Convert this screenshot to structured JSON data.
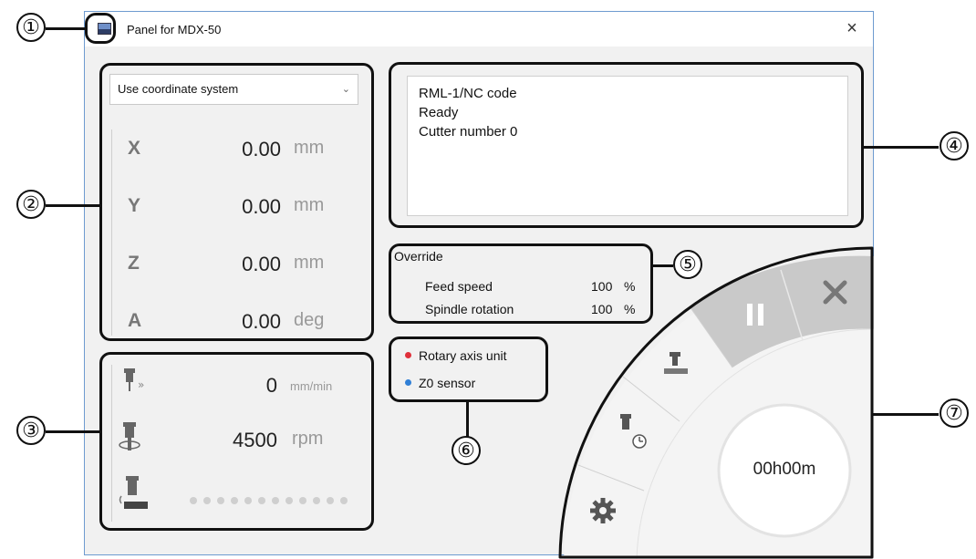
{
  "window": {
    "title": "Panel for MDX-50",
    "close_glyph": "×"
  },
  "coordinates": {
    "system_select": {
      "selected": "Use coordinate system"
    },
    "axes": [
      {
        "axis": "X",
        "value": "0.00",
        "unit": "mm"
      },
      {
        "axis": "Y",
        "value": "0.00",
        "unit": "mm"
      },
      {
        "axis": "Z",
        "value": "0.00",
        "unit": "mm"
      },
      {
        "axis": "A",
        "value": "0.00",
        "unit": "deg"
      }
    ]
  },
  "machine_status": {
    "feed_rate": {
      "value": "0",
      "unit": "mm/min",
      "icon": "feed-rate-icon"
    },
    "spindle_speed": {
      "value": "4500",
      "unit": "rpm",
      "icon": "spindle-icon"
    },
    "spindle_load": {
      "icon": "spindle-load-icon",
      "dots_total": 12,
      "dots_lit": 0
    }
  },
  "message": {
    "lines": [
      "RML-1/NC code",
      "Ready",
      "Cutter number 0"
    ]
  },
  "override": {
    "title": "Override",
    "rows": [
      {
        "label": "Feed speed",
        "value": "100",
        "unit": "%"
      },
      {
        "label": "Spindle rotation",
        "value": "100",
        "unit": "%"
      }
    ]
  },
  "indicators": [
    {
      "label": "Rotary axis unit",
      "color": "#e0303a"
    },
    {
      "label": "Z0 sensor",
      "color": "#2f7fd6"
    }
  ],
  "control_dial": {
    "pause_icon": "pause-icon",
    "cancel_icon": "cancel-icon",
    "cut_icon": "cutting-icon",
    "spindle_timer_icon": "spindle-timer-icon",
    "settings_icon": "gear-icon",
    "time_display": "00h00m"
  },
  "callouts": [
    "①",
    "②",
    "③",
    "④",
    "⑤",
    "⑥",
    "⑦"
  ],
  "colors": {
    "window_border": "#6e9bd0",
    "dial_active": "#c8c8c8",
    "panel_bg": "#f1f1f1"
  }
}
